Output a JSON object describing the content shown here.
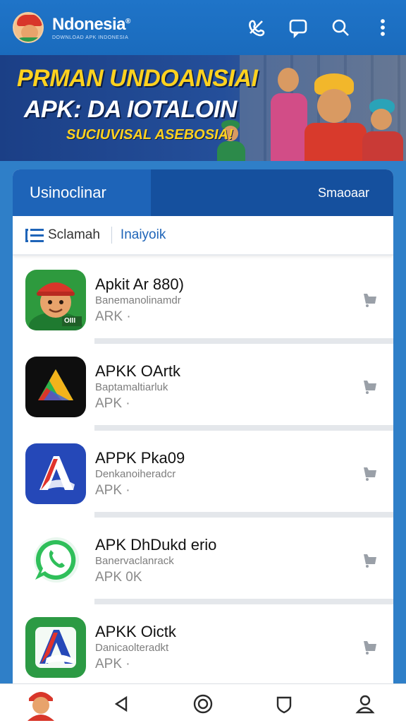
{
  "app": {
    "name": "Ndonesia",
    "reg_mark": "®",
    "tagline": "DOWNLOAD APK INDONESIA"
  },
  "toolbar": {
    "icons": [
      "phone-off-icon",
      "chat-icon",
      "search-icon",
      "more-vert-icon"
    ]
  },
  "banner": {
    "line1": "PRMAN UNDOANSIAI",
    "line2": "APK: DA IOTALOIN",
    "line3": "SUCIUVISAL ASEBOSIA!"
  },
  "card": {
    "tab_left": "Usinoclinar",
    "tab_right": "Smaoaar",
    "filter_label": "Sclamah",
    "filter_link": "Inaiyoik"
  },
  "apps": [
    {
      "title": "Apkit Ar 880)",
      "subtitle": "Banemanolinamdr",
      "meta": "ARK  ·",
      "icon": "mascot-app-icon",
      "icon_text": "OIII"
    },
    {
      "title": "APKK OArtk",
      "subtitle": "Baptamaltiarluk",
      "meta": "APK  ·",
      "icon": "triangle-app-icon",
      "icon_text": ""
    },
    {
      "title": "APPK Pka09",
      "subtitle": "Denkanoiheradcr",
      "meta": "APK  ·",
      "icon": "a-logo-app-icon",
      "icon_text": ""
    },
    {
      "title": "APK DhDukd erio",
      "subtitle": "Banervaclanrack",
      "meta": "APK   0K",
      "icon": "whatsapp-app-icon",
      "icon_text": ""
    },
    {
      "title": "APKK Oictk",
      "subtitle": "Danicaolteradkt",
      "meta": "APK  ·",
      "icon": "a-logo-green-app-icon",
      "icon_text": ""
    }
  ],
  "bottom_nav": [
    "avatar-nav-icon",
    "back-icon",
    "home-circle-icon",
    "shield-icon",
    "profile-icon"
  ],
  "colors": {
    "primary": "#1e64b8",
    "banner_yellow": "#ffd21f",
    "background": "#2f7fc8"
  }
}
